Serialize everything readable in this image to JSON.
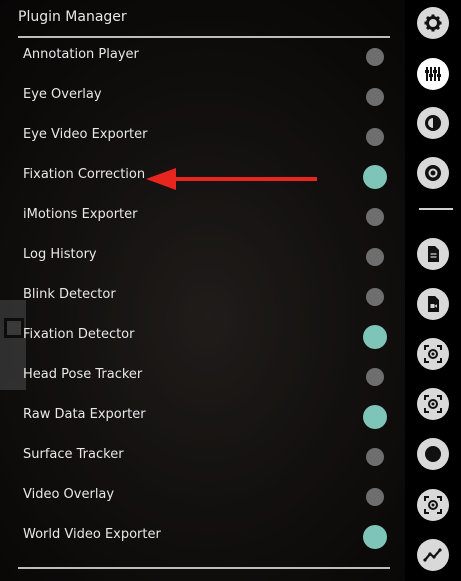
{
  "panel": {
    "title": "Plugin Manager",
    "plugins": [
      {
        "label": "Annotation Player",
        "enabled": false
      },
      {
        "label": "Eye Overlay",
        "enabled": false
      },
      {
        "label": "Eye Video Exporter",
        "enabled": false
      },
      {
        "label": "Fixation Correction",
        "enabled": true
      },
      {
        "label": "iMotions Exporter",
        "enabled": false
      },
      {
        "label": "Log History",
        "enabled": false
      },
      {
        "label": "Blink Detector",
        "enabled": false
      },
      {
        "label": "Fixation Detector",
        "enabled": true
      },
      {
        "label": "Head Pose Tracker",
        "enabled": false
      },
      {
        "label": "Raw Data Exporter",
        "enabled": true
      },
      {
        "label": "Surface Tracker",
        "enabled": false
      },
      {
        "label": "Video Overlay",
        "enabled": false
      },
      {
        "label": "World Video Exporter",
        "enabled": true
      }
    ]
  },
  "annotation": {
    "arrow_target": "Fixation Correction",
    "color": "#e8261f"
  },
  "colors": {
    "toggle_on": "#7ec4b8",
    "toggle_off": "#6e6e6e",
    "sidebar_button": "#d9d9d9"
  },
  "sidebar": {
    "buttons": [
      {
        "icon": "gear-icon",
        "active": false
      },
      {
        "icon": "plugin-sliders-icon",
        "active": true
      },
      {
        "icon": "eye-icon",
        "active": false
      },
      {
        "icon": "target-ring-icon",
        "active": false
      },
      {
        "icon": "document-icon",
        "active": false
      },
      {
        "icon": "video-file-icon",
        "active": false
      },
      {
        "icon": "focus-frame-icon",
        "active": false
      },
      {
        "icon": "focus-frame-icon",
        "active": false
      },
      {
        "icon": "record-dot-icon",
        "active": false
      },
      {
        "icon": "focus-frame-icon",
        "active": false
      },
      {
        "icon": "trend-line-icon",
        "active": false
      }
    ]
  }
}
